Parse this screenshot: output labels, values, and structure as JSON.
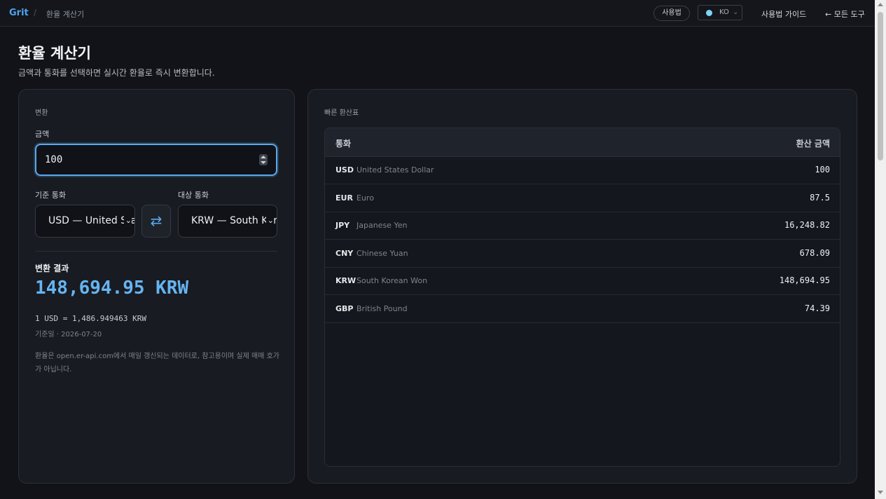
{
  "header": {
    "brand": "Grit",
    "separator": "/",
    "breadcrumb": "환율 계산기",
    "usage_pill": "사용법",
    "lang": {
      "code": "KO",
      "caret": "⌄"
    },
    "guide_link": "사용법 가이드",
    "all_tools_link": "← 모든 도구"
  },
  "page": {
    "title": "환율 계산기",
    "subtitle": "금액과 통화를 선택하면 실시간 환율로 즉시 변환합니다."
  },
  "converter": {
    "section_label": "변환",
    "amount_label": "금액",
    "amount_value": "100",
    "base_label": "기준 통화",
    "target_label": "대상 통화",
    "base_value": "USD — United States Dollar",
    "target_value": "KRW — South Korean Won",
    "caret": "⌄",
    "swap_icon": "⇄",
    "result_label": "변환 결과",
    "result_value": "148,694.95 KRW",
    "rate_line": "1 USD = 1,486.949463 KRW",
    "date_line": "기준일 · 2026-07-20",
    "note": "환율은 open.er-api.com에서 매일 갱신되는 데이터로, 참고용이며 실제 매매 호가가 아닙니다."
  },
  "quick_table": {
    "section_label": "빠른 환산표",
    "col_currency": "통화",
    "col_amount": "환산 금액",
    "rows": [
      {
        "code": "USD",
        "name": "United States Dollar",
        "amount": "100"
      },
      {
        "code": "EUR",
        "name": "Euro",
        "amount": "87.5"
      },
      {
        "code": "JPY",
        "name": "Japanese Yen",
        "amount": "16,248.82"
      },
      {
        "code": "CNY",
        "name": "Chinese Yuan",
        "amount": "678.09"
      },
      {
        "code": "KRW",
        "name": "South Korean Won",
        "amount": "148,694.95"
      },
      {
        "code": "GBP",
        "name": "British Pound",
        "amount": "74.39"
      }
    ]
  },
  "colors": {
    "accent": "#4ea3f0",
    "result": "#66b4f2",
    "background": "#111318",
    "card": "#181b21"
  }
}
